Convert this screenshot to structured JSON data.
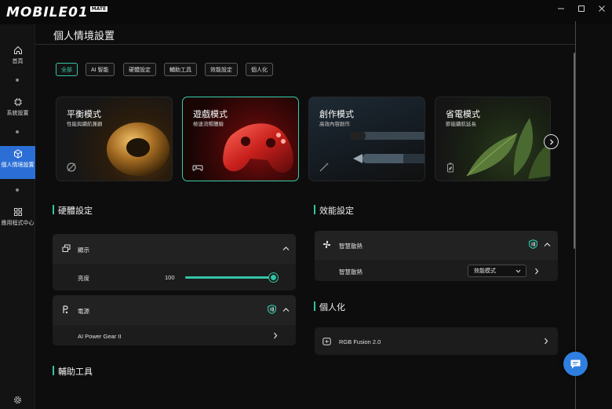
{
  "app": {
    "logo": "MOBILE01",
    "logo_badge": "MATE"
  },
  "window_controls": [
    "minimize",
    "maximize",
    "close"
  ],
  "sidebar": {
    "items": [
      {
        "label": "首頁",
        "icon": "home-icon"
      },
      {
        "label": "系統設置",
        "icon": "chip-icon"
      },
      {
        "label": "個人情境設置",
        "icon": "cube-icon",
        "active": true
      },
      {
        "label": "應用程式中心",
        "icon": "apps-grid-icon"
      }
    ],
    "footer_icon": "gear-icon"
  },
  "page": {
    "title": "個人情境設置"
  },
  "filters": {
    "items": [
      "全部",
      "AI 智能",
      "硬體設定",
      "輔助工具",
      "效能設定",
      "個人化"
    ],
    "active_index": 0
  },
  "mode_cards": [
    {
      "title": "平衡模式",
      "subtitle": "性能與續航兼顧",
      "icon": "balance-icon"
    },
    {
      "title": "遊戲模式",
      "subtitle": "極速流暢體驗",
      "icon": "gamepad-icon",
      "active": true
    },
    {
      "title": "創作模式",
      "subtitle": "高效內容創作",
      "icon": "wand-icon"
    },
    {
      "title": "省電模式",
      "subtitle": "節能續航延長",
      "icon": "battery-leaf-icon"
    }
  ],
  "hardware": {
    "section_title": "硬體設定",
    "display": {
      "label": "顯示",
      "brightness_label": "亮度",
      "brightness_value": "100",
      "brightness_fraction": 1.0
    },
    "power": {
      "label": "電源",
      "sub_item": "AI Power Gear II"
    }
  },
  "accessibility": {
    "section_title": "輔助工具"
  },
  "performance": {
    "section_title": "效能設定",
    "cooling": {
      "label": "智慧散熱",
      "row_label": "智慧散熱",
      "selected_option": "效能模式"
    }
  },
  "personalization": {
    "section_title": "個人化",
    "rgb": "RGB Fusion 2.0"
  },
  "colors": {
    "accent": "#33c4a4",
    "active_nav": "#2b6fd6",
    "chat_button": "#2f7fe0"
  }
}
